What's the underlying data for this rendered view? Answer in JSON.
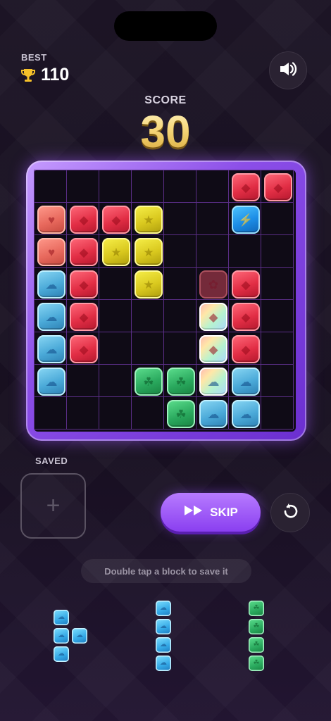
{
  "header": {
    "best_label": "BEST",
    "best_value": "110",
    "score_label": "SCORE",
    "score_value": "30"
  },
  "icons": {
    "trophy": "trophy-icon",
    "sound": "speaker-icon",
    "skip": "fast-forward-icon",
    "undo": "undo-icon",
    "plus": "plus-icon"
  },
  "board": {
    "rows": 8,
    "cols": 8,
    "symbols": {
      "heart": "heart",
      "diamond": "diamond",
      "star": "star",
      "bolt": "lightning",
      "cloud": "cloud",
      "leaf": "leaf"
    },
    "cells": [
      {
        "r": 0,
        "c": 6,
        "color": "red",
        "sym": "diamond"
      },
      {
        "r": 0,
        "c": 7,
        "color": "red",
        "sym": "diamond"
      },
      {
        "r": 1,
        "c": 0,
        "color": "salmon",
        "sym": "heart"
      },
      {
        "r": 1,
        "c": 1,
        "color": "red",
        "sym": "diamond"
      },
      {
        "r": 1,
        "c": 2,
        "color": "red",
        "sym": "diamond"
      },
      {
        "r": 1,
        "c": 3,
        "color": "yellow",
        "sym": "star"
      },
      {
        "r": 1,
        "c": 6,
        "color": "blue",
        "sym": "bolt"
      },
      {
        "r": 2,
        "c": 0,
        "color": "salmon",
        "sym": "heart"
      },
      {
        "r": 2,
        "c": 1,
        "color": "red",
        "sym": "diamond"
      },
      {
        "r": 2,
        "c": 2,
        "color": "yellow",
        "sym": "star"
      },
      {
        "r": 2,
        "c": 3,
        "color": "yellow",
        "sym": "star"
      },
      {
        "r": 3,
        "c": 0,
        "color": "cyan",
        "sym": "cloud"
      },
      {
        "r": 3,
        "c": 1,
        "color": "red",
        "sym": "diamond"
      },
      {
        "r": 3,
        "c": 3,
        "color": "yellow",
        "sym": "star"
      },
      {
        "r": 3,
        "c": 5,
        "color": "ghost",
        "sym": "flower"
      },
      {
        "r": 3,
        "c": 6,
        "color": "red",
        "sym": "diamond"
      },
      {
        "r": 4,
        "c": 0,
        "color": "cyan",
        "sym": "cloud"
      },
      {
        "r": 4,
        "c": 1,
        "color": "red",
        "sym": "diamond"
      },
      {
        "r": 4,
        "c": 5,
        "color": "rainbow",
        "sym": "diamond"
      },
      {
        "r": 4,
        "c": 6,
        "color": "red",
        "sym": "diamond"
      },
      {
        "r": 5,
        "c": 0,
        "color": "cyan",
        "sym": "cloud"
      },
      {
        "r": 5,
        "c": 1,
        "color": "red",
        "sym": "diamond"
      },
      {
        "r": 5,
        "c": 5,
        "color": "rainbow",
        "sym": "diamond"
      },
      {
        "r": 5,
        "c": 6,
        "color": "red",
        "sym": "diamond"
      },
      {
        "r": 6,
        "c": 0,
        "color": "cyan",
        "sym": "cloud"
      },
      {
        "r": 6,
        "c": 3,
        "color": "green",
        "sym": "leaf"
      },
      {
        "r": 6,
        "c": 4,
        "color": "green",
        "sym": "leaf"
      },
      {
        "r": 6,
        "c": 5,
        "color": "rainbow",
        "sym": "cloud"
      },
      {
        "r": 6,
        "c": 6,
        "color": "cyan",
        "sym": "cloud"
      },
      {
        "r": 7,
        "c": 4,
        "color": "green",
        "sym": "leaf"
      },
      {
        "r": 7,
        "c": 5,
        "color": "cyan",
        "sym": "cloud"
      },
      {
        "r": 7,
        "c": 6,
        "color": "cyan",
        "sym": "cloud"
      }
    ]
  },
  "saved": {
    "label": "SAVED"
  },
  "controls": {
    "skip_label": "SKIP"
  },
  "hint": "Double tap a block to save it",
  "tray": [
    {
      "color": "cyan",
      "sym": "cloud",
      "cells": [
        [
          0,
          0
        ],
        [
          1,
          0
        ],
        [
          1,
          1
        ],
        [
          2,
          0
        ]
      ]
    },
    {
      "color": "cyan",
      "sym": "cloud",
      "cells": [
        [
          0,
          0
        ],
        [
          1,
          0
        ],
        [
          2,
          0
        ],
        [
          3,
          0
        ]
      ]
    },
    {
      "color": "green",
      "sym": "leaf",
      "cells": [
        [
          0,
          0
        ],
        [
          1,
          0
        ],
        [
          2,
          0
        ],
        [
          3,
          0
        ]
      ]
    }
  ]
}
